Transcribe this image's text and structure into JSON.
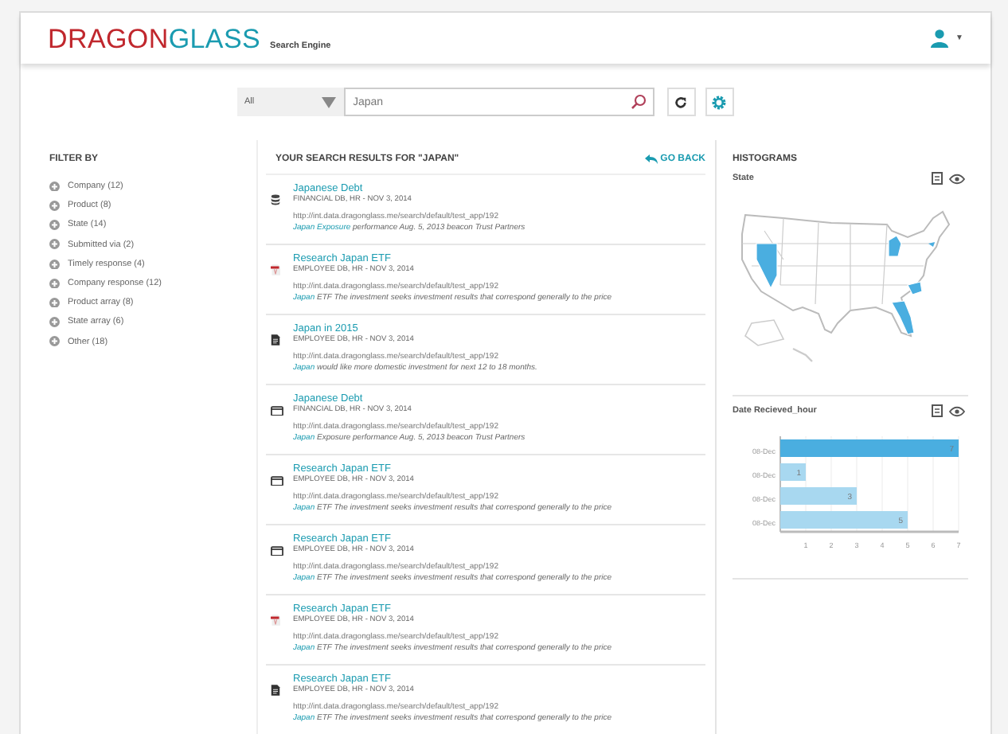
{
  "header": {
    "logo_part_1": "DRAGON",
    "logo_part_2": "GLASS",
    "subtitle": "Search Engine",
    "user_menu_caret": "▼"
  },
  "search": {
    "scope": "All",
    "query": "Japan"
  },
  "filters": {
    "title": "FILTER BY",
    "items": [
      {
        "label": "Company (12)"
      },
      {
        "label": "Product (8)"
      },
      {
        "label": "State (14)"
      },
      {
        "label": "Submitted via (2)"
      },
      {
        "label": "Timely response (4)"
      },
      {
        "label": "Company response (12)"
      },
      {
        "label": "Product array (8)"
      },
      {
        "label": "State array (6)"
      },
      {
        "label": "Other (18)"
      }
    ]
  },
  "results": {
    "title": "YOUR SEARCH RESULTS FOR \"JAPAN\"",
    "go_back": "GO BACK",
    "items": [
      {
        "kind": "database",
        "title": "Japanese Debt",
        "meta": "FINANCIAL DB, HR - NOV 3, 2014",
        "url": "http://int.data.dragonglass.me/search/default/test_app/192",
        "highlight": "Japan Exposure",
        "snippet": "performance Aug. 5, 2013 beacon Trust Partners"
      },
      {
        "kind": "pdf",
        "title": "Research Japan ETF",
        "meta": "EMPLOYEE DB, HR - NOV 3, 2014",
        "url": "http://int.data.dragonglass.me/search/default/test_app/192",
        "highlight": "Japan",
        "snippet": "ETF The investment seeks investment results that correspond generally to the price"
      },
      {
        "kind": "document",
        "title": "Japan in 2015",
        "meta": "EMPLOYEE DB, HR - NOV 3, 2014",
        "url": "http://int.data.dragonglass.me/search/default/test_app/192",
        "highlight": "Japan",
        "snippet": "would like more domestic investment for next 12 to 18 months."
      },
      {
        "kind": "window",
        "title": "Japanese Debt",
        "meta": "FINANCIAL DB, HR - NOV 3, 2014",
        "url": "http://int.data.dragonglass.me/search/default/test_app/192",
        "highlight": "Japan",
        "snippet": "Exposure performance Aug. 5, 2013 beacon Trust Partners"
      },
      {
        "kind": "window",
        "title": "Research Japan ETF",
        "meta": "EMPLOYEE DB, HR - NOV 3, 2014",
        "url": "http://int.data.dragonglass.me/search/default/test_app/192",
        "highlight": "Japan",
        "snippet": "ETF The investment seeks investment results that correspond generally to the price"
      },
      {
        "kind": "window",
        "title": "Research Japan ETF",
        "meta": "EMPLOYEE DB, HR - NOV 3, 2014",
        "url": "http://int.data.dragonglass.me/search/default/test_app/192",
        "highlight": "Japan",
        "snippet": "ETF The investment seeks investment results that correspond generally to the price"
      },
      {
        "kind": "pdf",
        "title": "Research Japan ETF",
        "meta": "EMPLOYEE DB, HR - NOV 3, 2014",
        "url": "http://int.data.dragonglass.me/search/default/test_app/192",
        "highlight": "Japan",
        "snippet": "ETF The investment seeks investment results that correspond generally to the price"
      },
      {
        "kind": "document",
        "title": "Research Japan ETF",
        "meta": "EMPLOYEE DB, HR - NOV 3, 2014",
        "url": "http://int.data.dragonglass.me/search/default/test_app/192",
        "highlight": "Japan",
        "snippet": "ETF The investment seeks investment results that correspond generally to the price"
      }
    ]
  },
  "histograms": {
    "title": "HISTOGRAMS",
    "panels": [
      {
        "kind": "map",
        "title": "State"
      },
      {
        "kind": "bar",
        "title": "Date Recieved_hour",
        "chart_data": {
          "type": "bar",
          "orientation": "horizontal",
          "stacked": true,
          "grid": true,
          "categories": [
            "08-Dec",
            "08-Dec",
            "08-Dec",
            "08-Dec"
          ],
          "series": [
            {
              "color": "#4aaee0",
              "values": [
                7,
                null,
                null,
                null
              ]
            },
            {
              "color": "#a8d8f0",
              "values": [
                null,
                1,
                3,
                5
              ]
            }
          ],
          "xlim": [
            0,
            7
          ],
          "xticks": [
            1,
            2,
            3,
            4,
            5,
            6,
            7
          ],
          "data_labels": true
        }
      }
    ]
  }
}
